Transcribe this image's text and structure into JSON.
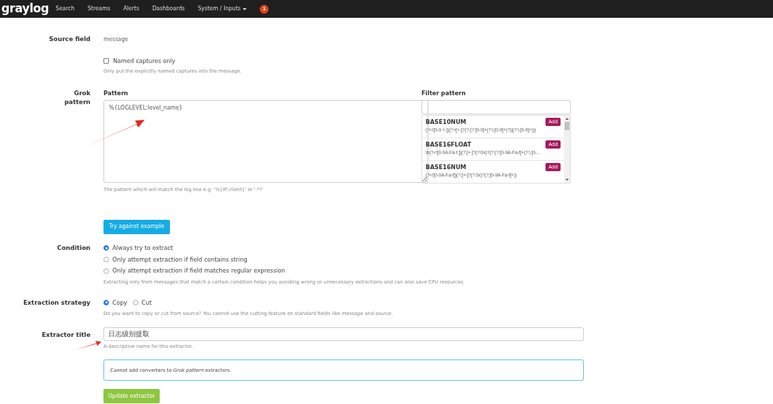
{
  "navbar": {
    "logo": "graylog",
    "items": [
      {
        "label": "Search",
        "dropdown": false
      },
      {
        "label": "Streams",
        "dropdown": false
      },
      {
        "label": "Alerts",
        "dropdown": false
      },
      {
        "label": "Dashboards",
        "dropdown": false
      },
      {
        "label": "System / Inputs",
        "dropdown": true
      }
    ],
    "notification_count": "1"
  },
  "source_field": {
    "label": "Source field",
    "value": "message"
  },
  "named_captures": {
    "label": "Named captures only",
    "checked": false,
    "help": "Only put the explicitly named captures into the message."
  },
  "grok_pattern": {
    "label": "Grok pattern",
    "pattern_label": "Pattern",
    "pattern_value": "%{LOGLEVEL:level_name}",
    "help": "The pattern which will match the log line e.g: '%{IP:client}' or '.*?'",
    "filter_label": "Filter pattern",
    "patterns": [
      {
        "name": "BASE10NUM",
        "add_label": "Add",
        "regex": "(?<![0-9.+-])(?>[+-]?(?:(?:[0-9]+(?:\\.[0-9]+)?)|(?:\\.[0-9]+)))"
      },
      {
        "name": "BASE16FLOAT",
        "add_label": "Add",
        "regex": "\\b(?<![0-9A-Fa-f.])(?:[+-]?(?:0x)?(?:(?:[0-9A-Fa-f]+(?:\\.[0-..."
      },
      {
        "name": "BASE16NUM",
        "add_label": "Add",
        "regex": "(?<![0-9A-Fa-f])(?:[+-]?(?:0x)?(?:[0-9A-Fa-f]+))"
      }
    ],
    "try_button": "Try against example"
  },
  "condition": {
    "label": "Condition",
    "options": [
      {
        "label": "Always try to extract",
        "selected": true
      },
      {
        "label": "Only attempt extraction if field contains string",
        "selected": false
      },
      {
        "label": "Only attempt extraction if field matches regular expression",
        "selected": false
      }
    ],
    "help": "Extracting only from messages that match a certain condition helps you avoiding wrong or unnecessary extractions and can also save CPU resources."
  },
  "extraction_strategy": {
    "label": "Extraction strategy",
    "options": [
      {
        "label": "Copy",
        "selected": true
      },
      {
        "label": "Cut",
        "selected": false
      }
    ],
    "help": "Do you want to copy or cut from source? You cannot use the cutting feature on standard fields like *message* and *source*."
  },
  "extractor_title": {
    "label": "Extractor title",
    "value": "日志级别提取",
    "help": "A descriptive name for this extractor."
  },
  "converters_note": "Cannot add converters to *Grok pattern* extractors.",
  "update_button": "Update extractor"
}
